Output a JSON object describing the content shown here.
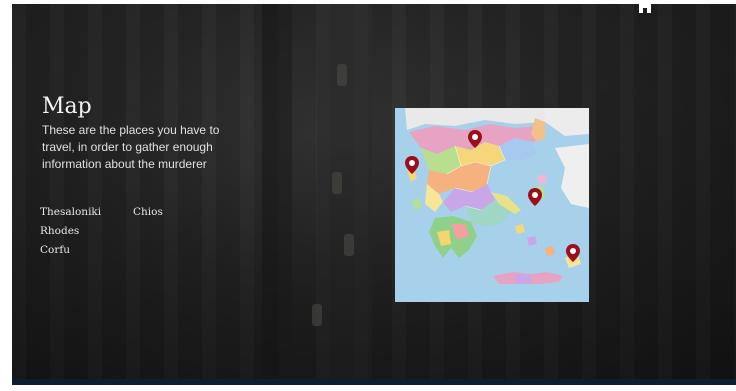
{
  "header": {
    "home_icon": "home-icon"
  },
  "content": {
    "title": "Map",
    "description": "These are the places you have to travel, in order to gather enough information about the murderer"
  },
  "places": [
    "Thesaloniki",
    "Chios",
    "Rhodes",
    "Corfu"
  ],
  "map": {
    "markers": [
      "map-marker-icon",
      "map-marker-icon",
      "map-marker-icon",
      "map-marker-icon"
    ]
  },
  "colors": {
    "background": "#1e1e1e",
    "text": "#e8e8e8",
    "sea": "#9fcbe6",
    "marker": "#9b0f1a"
  }
}
